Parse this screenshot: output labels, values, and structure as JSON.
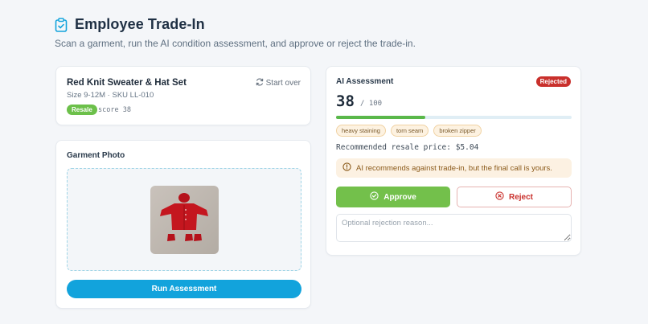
{
  "header": {
    "title": "Employee Trade-In",
    "subtitle": "Scan a garment, run the AI condition assessment, and approve or reject the trade-in."
  },
  "item": {
    "name": "Red Knit Sweater & Hat Set",
    "meta": "Size 9-12M · SKU LL-010",
    "badge": "Resale",
    "score_text": "score 38",
    "start_over_label": "Start over"
  },
  "photo_section": {
    "title": "Garment Photo",
    "run_button_label": "Run Assessment"
  },
  "assessment": {
    "title": "AI Assessment",
    "status_badge": "Rejected",
    "score": "38",
    "score_max": "/ 100",
    "score_fraction": 0.38,
    "tags": [
      "heavy staining",
      "torn seam",
      "broken zipper"
    ],
    "resale_price": "Recommended resale price: $5.04",
    "warning": "AI recommends against trade-in, but the final call is yours.",
    "approve_label": "Approve",
    "reject_label": "Reject",
    "reason_placeholder": "Optional rejection reason..."
  },
  "colors": {
    "accent": "#12a3dc",
    "approve": "#73c04b",
    "reject": "#c9302c",
    "resale_badge": "#6cc04a"
  }
}
